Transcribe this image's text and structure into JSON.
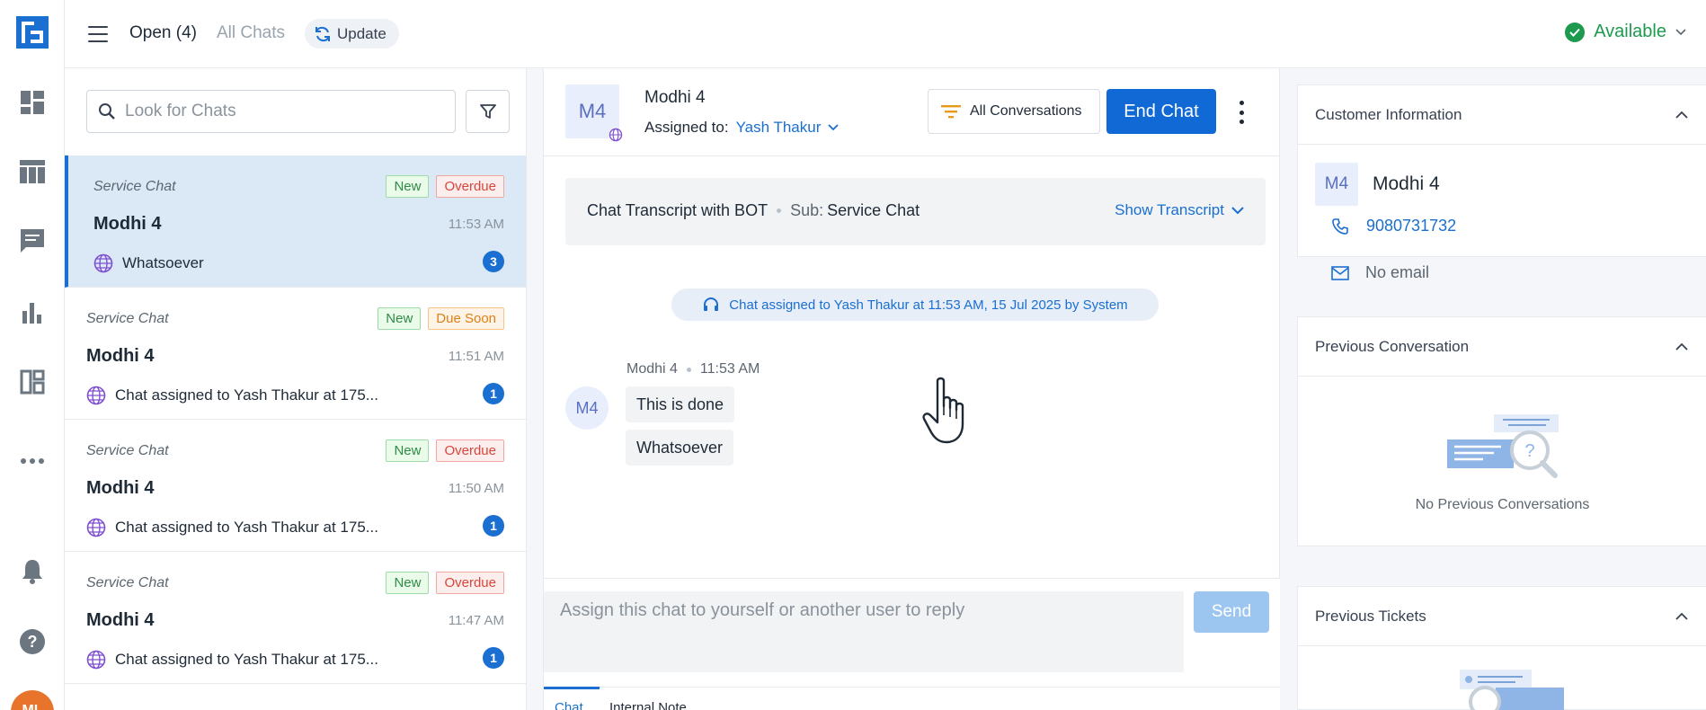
{
  "topbar": {
    "tab_open": "Open (4)",
    "tab_all": "All Chats",
    "update_label": "Update",
    "status_label": "Available"
  },
  "user": {
    "initials": "ML"
  },
  "chat_list": {
    "search_placeholder": "Look for Chats",
    "items": [
      {
        "type": "Service Chat",
        "badges": [
          "New",
          "Overdue"
        ],
        "name": "Modhi 4",
        "time": "11:53 AM",
        "preview": "Whatsoever",
        "count": "3"
      },
      {
        "type": "Service Chat",
        "badges": [
          "New",
          "Due Soon"
        ],
        "name": "Modhi 4",
        "time": "11:51 AM",
        "preview": "Chat assigned to Yash Thakur at 175...",
        "count": "1"
      },
      {
        "type": "Service Chat",
        "badges": [
          "New",
          "Overdue"
        ],
        "name": "Modhi 4",
        "time": "11:50 AM",
        "preview": "Chat assigned to Yash Thakur at 175...",
        "count": "1"
      },
      {
        "type": "Service Chat",
        "badges": [
          "New",
          "Overdue"
        ],
        "name": "Modhi 4",
        "time": "11:47 AM",
        "preview": "Chat assigned to Yash Thakur at 175...",
        "count": "1"
      }
    ]
  },
  "conversation": {
    "avatar": "M4",
    "name": "Modhi 4",
    "assigned_label": "Assigned to:",
    "assigned_to": "Yash Thakur",
    "all_conversations": "All Conversations",
    "end_chat": "End Chat",
    "transcript_label": "Chat Transcript with BOT",
    "transcript_sub_label": "Sub:",
    "transcript_sub": "Service Chat",
    "show_transcript": "Show Transcript",
    "system_message": {
      "prefix": "Chat assigned to",
      "who": "Yash Thakur",
      "at": "at",
      "when": "11:53 AM, 15 Jul 2025",
      "by": "by",
      "actor": "System"
    },
    "message": {
      "sender": "Modhi 4",
      "time": "11:53 AM",
      "bubbles": [
        "This is done",
        "Whatsoever"
      ]
    },
    "composer_placeholder": "Assign this chat to yourself or another user to reply",
    "send_label": "Send",
    "tabs": [
      "Chat",
      "Internal Note"
    ]
  },
  "customer_info": {
    "title": "Customer Information",
    "avatar": "M4",
    "name": "Modhi 4",
    "phone": "9080731732",
    "email": "No email"
  },
  "previous_conversation": {
    "title": "Previous Conversation",
    "empty_text": "No Previous Conversations"
  },
  "previous_tickets": {
    "title": "Previous Tickets"
  },
  "colors": {
    "accent": "#1169d6",
    "available": "#1e9a4f",
    "overdue": "#d9453b",
    "due_soon": "#df7f17",
    "new": "#2e8b45"
  }
}
